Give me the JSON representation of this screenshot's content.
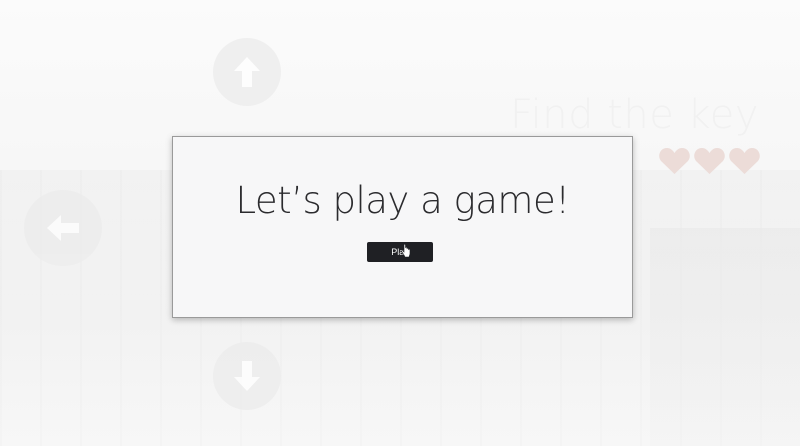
{
  "background": {
    "title": "Find the key",
    "hearts": [
      "heart-icon",
      "heart-icon",
      "heart-icon"
    ],
    "controls": {
      "up": "arrow-up-icon",
      "left": "arrow-left-icon",
      "down": "arrow-down-icon"
    }
  },
  "modal": {
    "title": "Let’s play a game!",
    "play_label": "Play"
  },
  "colors": {
    "button_bg": "#1f2024",
    "button_text": "#ffffff",
    "heart": "#e9d7d3"
  }
}
